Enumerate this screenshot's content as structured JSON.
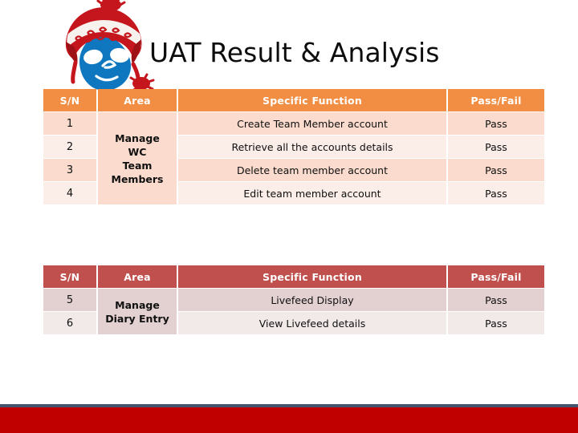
{
  "slide": {
    "title": "UAT Result & Analysis",
    "logo_name": "drupal-druplicon-winter-hat-logo",
    "background_color": "#FFFFFF",
    "footer_rule_color": "#44546A",
    "footer_band_color": "#C00000"
  },
  "table1": {
    "name": "uat-results-manage-wc-team-members",
    "theme": {
      "header_bg": "#F28E43",
      "header_text": "#FFFFFF",
      "row_band_a": "#FADBCD",
      "row_band_b": "#FBEDE8"
    },
    "headers": [
      "S/N",
      "Area",
      "Specific Function",
      "Pass/Fail"
    ],
    "area": "Manage WC Team Members",
    "area_lines": [
      "Manage",
      "WC",
      "Team",
      "Members"
    ],
    "rows": [
      {
        "sn": "1",
        "function": "Create Team Member account",
        "result": "Pass"
      },
      {
        "sn": "2",
        "function": "Retrieve all the accounts details",
        "result": "Pass"
      },
      {
        "sn": "3",
        "function": "Delete team member account",
        "result": "Pass"
      },
      {
        "sn": "4",
        "function": "Edit team member account",
        "result": "Pass"
      }
    ]
  },
  "table2": {
    "name": "uat-results-manage-diary-entry",
    "theme": {
      "header_bg": "#C0504D",
      "header_text": "#FFFFFF",
      "row_band_a": "#E3D1D2",
      "row_band_b": "#F2E9E9"
    },
    "headers": [
      "S/N",
      "Area",
      "Specific Function",
      "Pass/Fail"
    ],
    "area": "Manage Diary Entry",
    "area_lines": [
      "Manage",
      "Diary Entry"
    ],
    "rows": [
      {
        "sn": "5",
        "function": "Livefeed Display",
        "result": "Pass"
      },
      {
        "sn": "6",
        "function": "View Livefeed details",
        "result": "Pass"
      }
    ]
  }
}
